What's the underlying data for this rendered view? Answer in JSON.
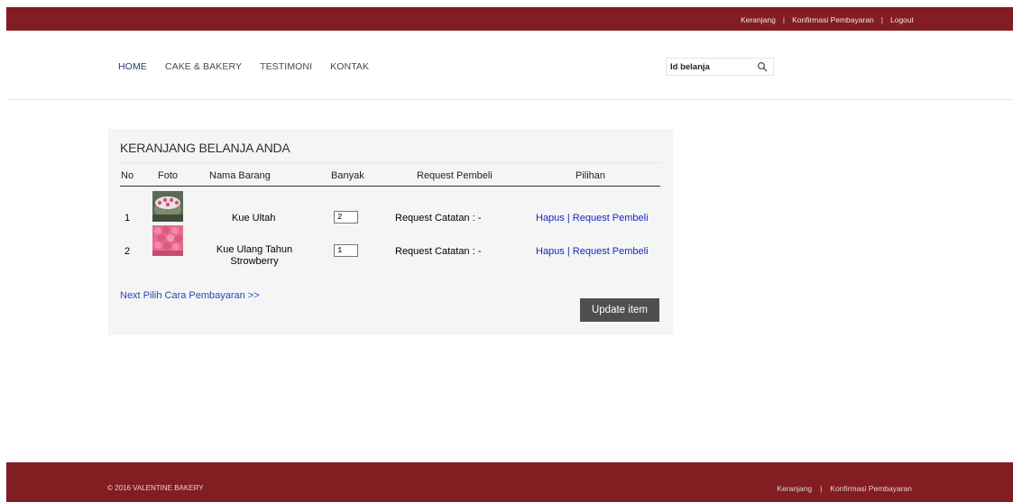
{
  "topbar": {
    "links": [
      "Keranjang",
      "Konfirmasi Pembayaran",
      "Logout"
    ],
    "separator": "|"
  },
  "nav": {
    "items": [
      "HOME",
      "CAKE & BAKERY",
      "TESTIMONI",
      "KONTAK"
    ],
    "active": "HOME"
  },
  "search": {
    "placeholder": "Id belanja",
    "icon": "search-icon"
  },
  "cart": {
    "title": "KERANJANG BELANJA ANDA",
    "columns": [
      "No",
      "Foto",
      "Nama Barang",
      "Banyak",
      "Request Pembeli",
      "Pilihan"
    ],
    "rows": [
      {
        "no": "1",
        "photo": "cake-photo",
        "name": "Kue Ultah",
        "qty": "2",
        "request": "Request Catatan : -",
        "action_delete": "Hapus",
        "action_sep": "|",
        "action_request": "Request Pembeli"
      },
      {
        "no": "2",
        "photo": "cake-photo",
        "name_line1": "Kue Ulang Tahun",
        "name_line2": "Strowberry",
        "qty": "1",
        "request": "Request Catatan : -",
        "action_delete": "Hapus",
        "action_sep": "|",
        "action_request": "Request Pembeli"
      }
    ],
    "next_link": "Next Pilih Cara Pembayaran >>",
    "update_button": "Update item"
  },
  "footer": {
    "copyright": "© 2016 VALENTINE BAKERY",
    "links": [
      "Keranjang",
      "Konfirmasi Pembayaran"
    ],
    "separator": "|"
  },
  "colors": {
    "brand": "#821d22",
    "link": "#1726c0",
    "button": "#4f4f4f",
    "panel": "#f5f5f5"
  }
}
